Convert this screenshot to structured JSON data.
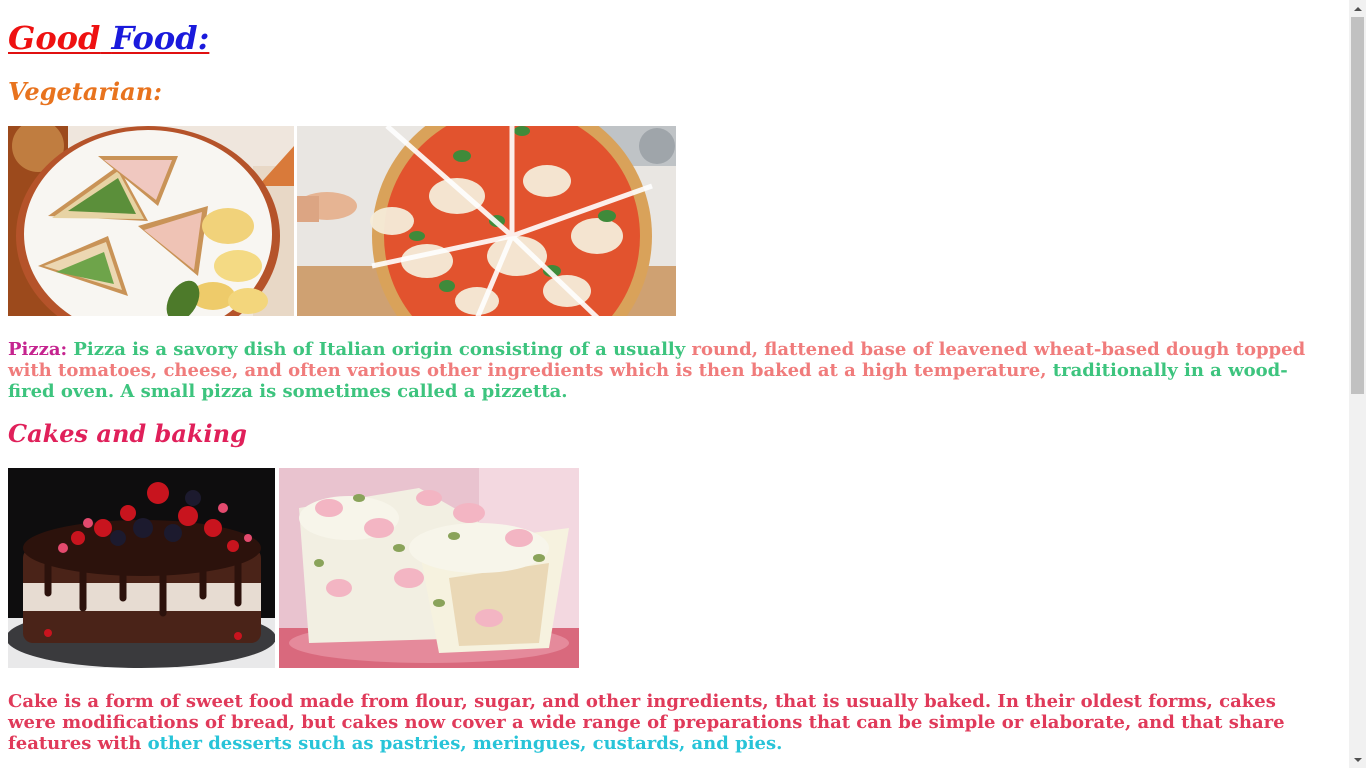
{
  "header": {
    "title_word1": "Good",
    "title_word2": "Food:"
  },
  "vegetarian": {
    "heading": "Vegetarian:",
    "images": [
      {
        "alt": "club sandwich with chips",
        "icon": "sandwich-photo"
      },
      {
        "alt": "margherita pizza sliced",
        "icon": "pizza-photo"
      }
    ],
    "description": {
      "label": "Pizza:",
      "part1": " Pizza is a savory dish of Italian origin consisting of a usually ",
      "part2": "round, flattened base of leavened wheat-based dough topped with tomatoes, cheese, and often various other ingredients which is then baked at a high temperature,",
      "part3": " traditionally in a wood-fired oven. A small pizza is sometimes called a pizzetta."
    }
  },
  "cakes": {
    "heading": "Cakes and baking",
    "images": [
      {
        "alt": "chocolate layer cake with berries",
        "icon": "chocolate-cake-photo"
      },
      {
        "alt": "cream cake with rose petals",
        "icon": "cream-cake-photo"
      }
    ],
    "description": {
      "part1": "Cake is a form of sweet food made from flour, sugar, and other ingredients, that is usually baked. In their oldest forms, cakes were modifications of bread, but cakes now cover a wide range of preparations that can be simple or elaborate, and that share features with",
      "part2": " other desserts such as pastries, meringues, custards, and pies."
    }
  },
  "colors": {
    "title_good": "#ee1111",
    "title_food": "#1a1adc",
    "veg_heading": "#e8731e",
    "cake_heading": "#e0205a",
    "label_magenta": "#c5248f",
    "text_green": "#3dc47e",
    "text_salmon": "#f07c7c",
    "text_crimson": "#e03a5a",
    "text_cyan": "#28c4d8"
  }
}
